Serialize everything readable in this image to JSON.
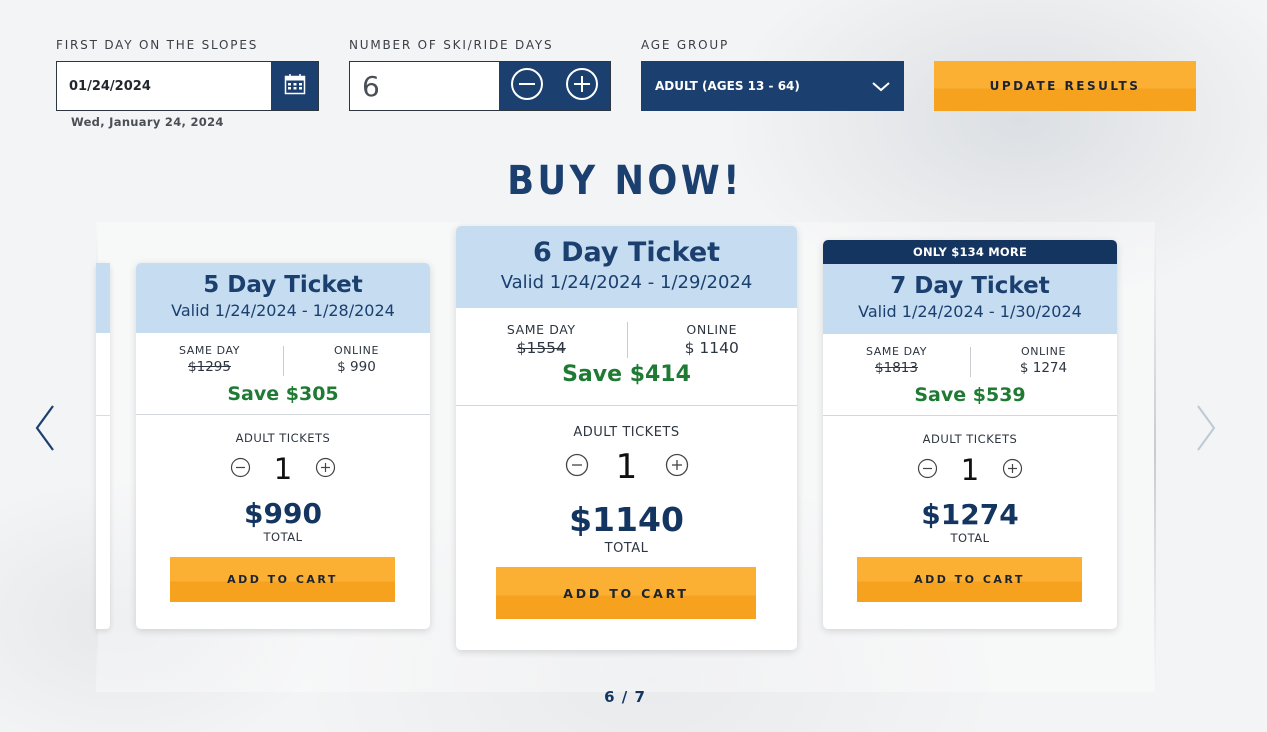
{
  "filters": {
    "date_label": "FIRST DAY ON THE SLOPES",
    "date_value": "01/24/2024",
    "date_long": "Wed, January 24, 2024",
    "days_label": "NUMBER OF SKI/RIDE DAYS",
    "days_value": "6",
    "age_label": "AGE GROUP",
    "age_value": "ADULT (AGES 13 - 64)",
    "update_label": "UPDATE RESULTS"
  },
  "heading": "BUY NOW!",
  "cards": [
    {
      "badge": "",
      "title": "5 Day Ticket",
      "valid": "Valid 1/24/2024 - 1/28/2024",
      "same_day_label": "SAME DAY",
      "same_day_price": "$1295",
      "online_label": "ONLINE",
      "online_price": "$ 990",
      "save": "Save $305",
      "qty_label": "ADULT TICKETS",
      "qty": "1",
      "total": "$990",
      "total_label": "TOTAL",
      "cart_label": "ADD TO CART"
    },
    {
      "badge": "",
      "title": "6 Day Ticket",
      "valid": "Valid 1/24/2024 - 1/29/2024",
      "same_day_label": "SAME DAY",
      "same_day_price": "$1554",
      "online_label": "ONLINE",
      "online_price": "$ 1140",
      "save": "Save $414",
      "qty_label": "ADULT TICKETS",
      "qty": "1",
      "total": "$1140",
      "total_label": "TOTAL",
      "cart_label": "ADD TO CART"
    },
    {
      "badge": "ONLY $134 MORE",
      "title": "7 Day Ticket",
      "valid": "Valid 1/24/2024 - 1/30/2024",
      "same_day_label": "SAME DAY",
      "same_day_price": "$1813",
      "online_label": "ONLINE",
      "online_price": "$ 1274",
      "save": "Save $539",
      "qty_label": "ADULT TICKETS",
      "qty": "1",
      "total": "$1274",
      "total_label": "TOTAL",
      "cart_label": "ADD TO CART"
    }
  ],
  "pager": "6 / 7",
  "icons": {
    "calendar": "calendar-icon",
    "minus": "minus-circle-icon",
    "plus": "plus-circle-icon",
    "dropdown": "chevron-down-icon",
    "prev": "chevron-left-icon",
    "next": "chevron-right-icon"
  },
  "colors": {
    "navy": "#1b3f6e",
    "accent_orange": "#fbb034",
    "card_header": "#c5dcf1",
    "save_green": "#1f7a34"
  }
}
